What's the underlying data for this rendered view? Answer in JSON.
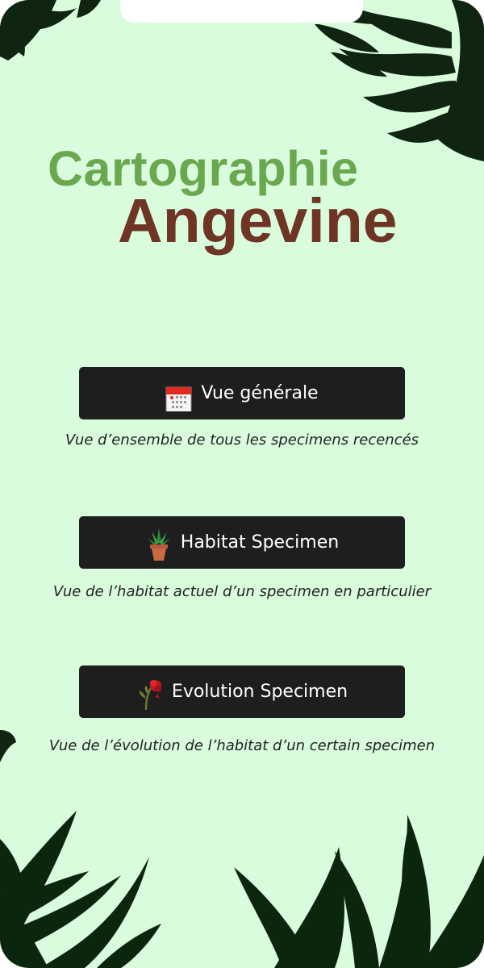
{
  "app": {
    "title_line1": "Cartographie",
    "title_line2": "Angevine"
  },
  "colors": {
    "background": "#d9fcdd",
    "title_green": "#6aa84f",
    "title_brown": "#6e3424",
    "button_bg": "#1e1e1e",
    "button_text": "#ffffff",
    "foliage": "#0e2a0f"
  },
  "menu": [
    {
      "icon": "calendar-icon",
      "label": "Vue générale",
      "description": "Vue d’ensemble de tous les specimens recencés"
    },
    {
      "icon": "potted-plant-icon",
      "label": "Habitat Specimen",
      "description": "Vue de l’habitat actuel d’un specimen en particulier"
    },
    {
      "icon": "wilted-flower-icon",
      "label": "Evolution Specimen",
      "description": "Vue de l’évolution de l’habitat d’un certain specimen"
    }
  ]
}
